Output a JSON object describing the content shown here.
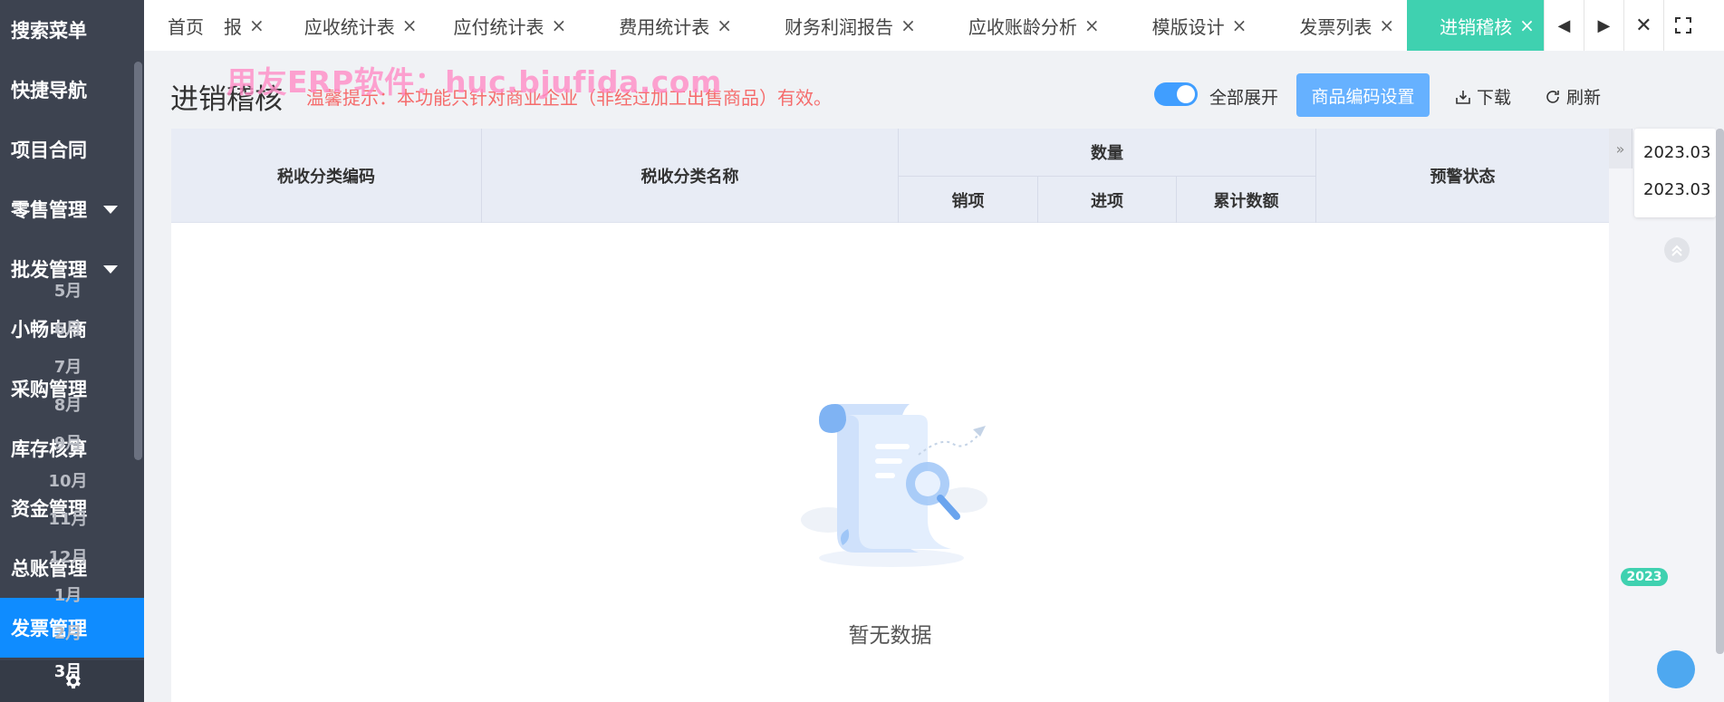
{
  "sidebar": {
    "items": [
      {
        "label": "搜索菜单"
      },
      {
        "label": "快捷导航"
      },
      {
        "label": "项目合同"
      },
      {
        "label": "零售管理"
      },
      {
        "label": "批发管理"
      },
      {
        "label": "小畅电商"
      },
      {
        "label": "采购管理"
      },
      {
        "label": "库存核算"
      },
      {
        "label": "资金管理"
      },
      {
        "label": "总账管理"
      },
      {
        "label": "发票管理"
      }
    ],
    "active": "发票管理",
    "settings_icon": "gear-icon"
  },
  "tabs": [
    {
      "label": "首页",
      "closable": false
    },
    {
      "label": "报",
      "closable": true
    },
    {
      "label": "应收统计表",
      "closable": true
    },
    {
      "label": "应付统计表",
      "closable": true
    },
    {
      "label": "费用统计表",
      "closable": true
    },
    {
      "label": "财务利润报告",
      "closable": true
    },
    {
      "label": "应收账龄分析",
      "closable": true
    },
    {
      "label": "模版设计",
      "closable": true
    },
    {
      "label": "发票列表",
      "closable": true
    },
    {
      "label": "进销稽核",
      "closable": true,
      "active": true
    }
  ],
  "tab_close_glyph": "×",
  "page": {
    "title": "进销稽核",
    "watermark": "用友ERP软件：huc.bjufida.com",
    "hint": "温馨提示：本功能只针对商业企业（非经过加工出售商品）有效。",
    "toggle_label": "全部展开",
    "toggle_on": true,
    "btn_code_settings": "商品编码设置",
    "btn_download": "下载",
    "btn_refresh": "刷新"
  },
  "table": {
    "col_code": "税收分类编码",
    "col_name": "税收分类名称",
    "col_qty": "数量",
    "col_sales": "销项",
    "col_purchase": "进项",
    "col_cumulative": "累计数额",
    "col_warning": "预警状态",
    "empty_text": "暂无数据"
  },
  "rail": {
    "date_start": "2023.03",
    "date_end": "2023.03",
    "year_badge": "2023",
    "months": [
      "5月",
      "6月",
      "7月",
      "8月",
      "9月",
      "10月",
      "11月",
      "12月",
      "1月",
      "2月",
      "3月"
    ],
    "active_month": "3月"
  },
  "colors": {
    "sidebar_bg": "#3d4350",
    "active_blue": "#0f8cff",
    "tab_active": "#3fd1b0",
    "primary_button": "#66b1ff",
    "hint_red": "#f56c6c",
    "watermark_pink": "#ff8cc6"
  }
}
